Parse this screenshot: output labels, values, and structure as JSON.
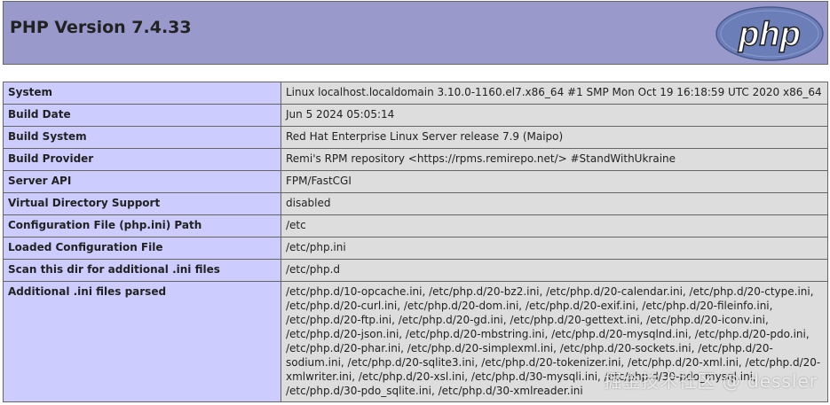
{
  "header": {
    "title": "PHP Version 7.4.33",
    "logo_text": "php",
    "colors": {
      "header_bg": "#9999cc",
      "label_bg": "#ccccff",
      "value_bg": "#dddddd",
      "border": "#666666"
    }
  },
  "rows": [
    {
      "label": "System",
      "value": "Linux localhost.localdomain 3.10.0-1160.el7.x86_64 #1 SMP Mon Oct 19 16:18:59 UTC 2020 x86_64"
    },
    {
      "label": "Build Date",
      "value": "Jun 5 2024 05:05:14"
    },
    {
      "label": "Build System",
      "value": "Red Hat Enterprise Linux Server release 7.9 (Maipo)"
    },
    {
      "label": "Build Provider",
      "value": "Remi's RPM repository <https://rpms.remirepo.net/> #StandWithUkraine"
    },
    {
      "label": "Server API",
      "value": "FPM/FastCGI"
    },
    {
      "label": "Virtual Directory Support",
      "value": "disabled"
    },
    {
      "label": "Configuration File (php.ini) Path",
      "value": "/etc"
    },
    {
      "label": "Loaded Configuration File",
      "value": "/etc/php.ini"
    },
    {
      "label": "Scan this dir for additional .ini files",
      "value": "/etc/php.d"
    },
    {
      "label": "Additional .ini files parsed",
      "value": "/etc/php.d/10-opcache.ini, /etc/php.d/20-bz2.ini, /etc/php.d/20-calendar.ini, /etc/php.d/20-ctype.ini, /etc/php.d/20-curl.ini, /etc/php.d/20-dom.ini, /etc/php.d/20-exif.ini, /etc/php.d/20-fileinfo.ini, /etc/php.d/20-ftp.ini, /etc/php.d/20-gd.ini, /etc/php.d/20-gettext.ini, /etc/php.d/20-iconv.ini, /etc/php.d/20-json.ini, /etc/php.d/20-mbstring.ini, /etc/php.d/20-mysqlnd.ini, /etc/php.d/20-pdo.ini, /etc/php.d/20-phar.ini, /etc/php.d/20-simplexml.ini, /etc/php.d/20-sockets.ini, /etc/php.d/20-sodium.ini, /etc/php.d/20-sqlite3.ini, /etc/php.d/20-tokenizer.ini, /etc/php.d/20-xml.ini, /etc/php.d/20-xmlwriter.ini, /etc/php.d/20-xsl.ini, /etc/php.d/30-mysqli.ini, /etc/php.d/30-pdo_mysql.ini, /etc/php.d/30-pdo_sqlite.ini, /etc/php.d/30-xmlreader.ini"
    }
  ],
  "watermark": "掘金技术社区 @ dessler"
}
